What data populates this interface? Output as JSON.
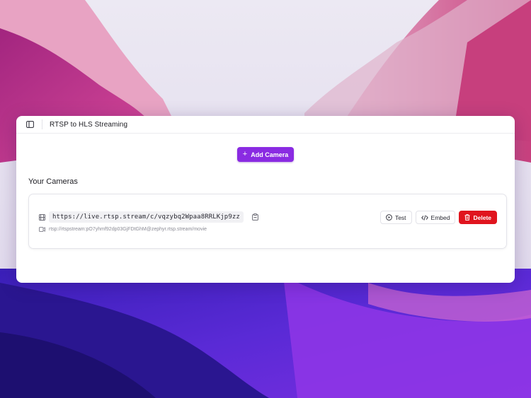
{
  "window": {
    "title": "RTSP to HLS Streaming"
  },
  "toolbar": {
    "add_camera_label": "Add Camera",
    "add_icon": "+"
  },
  "section": {
    "title": "Your Cameras"
  },
  "cameras": [
    {
      "hls_url": "https://live.rtsp.stream/c/vqzybq2Wpaa8RRLKjp9zz",
      "rtsp_url": "rtsp://rtspstream:pO7yhmf92dp03GjFDtGhM@zephyr.rtsp.stream/movie",
      "actions": {
        "test_label": "Test",
        "embed_label": "Embed",
        "delete_label": "Delete"
      }
    }
  ],
  "icons": {
    "sidebar": "sidebar-panel-icon",
    "film": "film-icon",
    "copy": "clipboard-copy-icon",
    "video": "video-camera-icon",
    "play": "play-circle-icon",
    "code": "code-icon",
    "trash": "trash-icon"
  },
  "colors": {
    "accent": "#8a2be2",
    "danger": "#e0141e"
  }
}
